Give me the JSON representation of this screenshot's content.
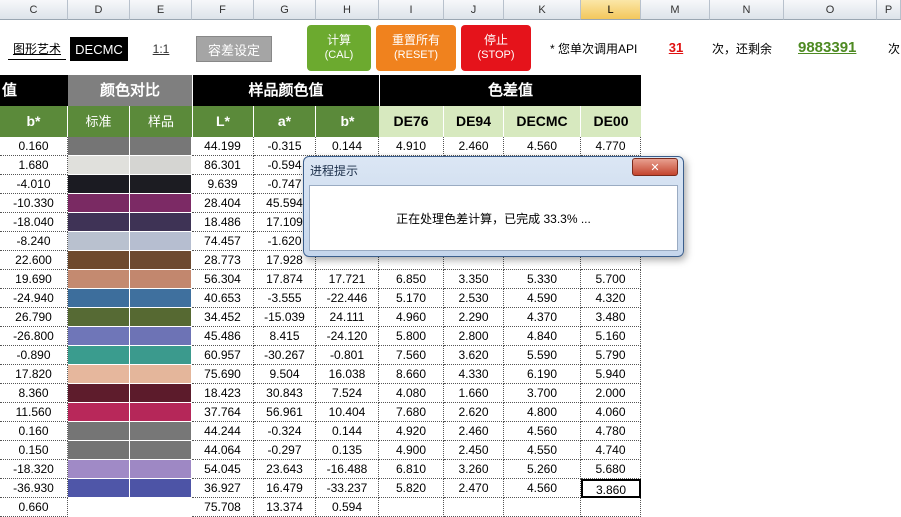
{
  "columns": [
    "C",
    "D",
    "E",
    "F",
    "G",
    "H",
    "I",
    "J",
    "K",
    "L",
    "M",
    "N",
    "O",
    "P"
  ],
  "controls": {
    "art_text": "图形艺术",
    "formula": "DECMC",
    "ratio": "1:1",
    "tolerance_btn": "容差设定",
    "calc_btn": {
      "label": "计算",
      "sub": "(CAL)"
    },
    "reset_btn": {
      "label": "重置所有",
      "sub": "(RESET)"
    },
    "stop_btn": {
      "label": "停止",
      "sub": "(STOP)"
    },
    "api_label": "* 您单次调用API",
    "api_count": "31",
    "remain_label": "次，还剩余",
    "remain_count": "9883391",
    "tail": "次"
  },
  "headers": {
    "value_partial": "值",
    "color_compare": "颜色对比",
    "sample_color": "样品颜色值",
    "color_diff": "色差值",
    "b_std": "b*",
    "standard": "标准",
    "sample": "样品",
    "L": "L*",
    "a": "a*",
    "b": "b*",
    "de76": "DE76",
    "de94": "DE94",
    "decmc": "DECMC",
    "de00": "DE00"
  },
  "rows": [
    {
      "b": "0.160",
      "std": "#757575",
      "smp": "#777777",
      "L": "44.199",
      "a": "-0.315",
      "bb": "0.144",
      "de76": "4.910",
      "de94": "2.460",
      "decmc": "4.560",
      "de00": "4.770"
    },
    {
      "b": "1.680",
      "std": "#e0e0dc",
      "smp": "#d5d5d2",
      "L": "86.301",
      "a": "-0.594",
      "bb": "",
      "de76": "",
      "de94": "",
      "decmc": "",
      "de00": ""
    },
    {
      "b": "-4.010",
      "std": "#1b1b22",
      "smp": "#1c1c22",
      "L": "9.639",
      "a": "-0.747",
      "bb": "",
      "de76": "",
      "de94": "",
      "decmc": "",
      "de00": ""
    },
    {
      "b": "-10.330",
      "std": "#7a2a63",
      "smp": "#7c2a65",
      "L": "28.404",
      "a": "45.594",
      "bb": "",
      "de76": "",
      "de94": "",
      "decmc": "",
      "de00": ""
    },
    {
      "b": "-18.040",
      "std": "#3f3356",
      "smp": "#3e3355",
      "L": "18.486",
      "a": "17.109",
      "bb": "",
      "de76": "",
      "de94": "",
      "decmc": "",
      "de00": ""
    },
    {
      "b": "-8.240",
      "std": "#b9c1cf",
      "smp": "#b6bed0",
      "L": "74.457",
      "a": "-1.620",
      "bb": "",
      "de76": "",
      "de94": "",
      "decmc": "",
      "de00": ""
    },
    {
      "b": "22.600",
      "std": "#6e4a2e",
      "smp": "#6d4a30",
      "L": "28.773",
      "a": "17.928",
      "bb": "",
      "de76": "",
      "de94": "",
      "decmc": "",
      "de00": ""
    },
    {
      "b": "19.690",
      "std": "#c48a70",
      "smp": "#c2876e",
      "L": "56.304",
      "a": "17.874",
      "bb": "17.721",
      "de76": "6.850",
      "de94": "3.350",
      "decmc": "5.330",
      "de00": "5.700"
    },
    {
      "b": "-24.940",
      "std": "#3d6e9c",
      "smp": "#3f709e",
      "L": "40.653",
      "a": "-3.555",
      "bb": "-22.446",
      "de76": "5.170",
      "de94": "2.530",
      "decmc": "4.590",
      "de00": "4.320"
    },
    {
      "b": "26.790",
      "std": "#566a34",
      "smp": "#566932",
      "L": "34.452",
      "a": "-15.039",
      "bb": "24.111",
      "de76": "4.960",
      "de94": "2.290",
      "decmc": "4.370",
      "de00": "3.480"
    },
    {
      "b": "-26.800",
      "std": "#6f76b8",
      "smp": "#6d73b5",
      "L": "45.486",
      "a": "8.415",
      "bb": "-24.120",
      "de76": "5.800",
      "de94": "2.800",
      "decmc": "4.840",
      "de00": "5.160"
    },
    {
      "b": "-0.890",
      "std": "#3a9c8e",
      "smp": "#3b9a8d",
      "L": "60.957",
      "a": "-30.267",
      "bb": "-0.801",
      "de76": "7.560",
      "de94": "3.620",
      "decmc": "5.590",
      "de00": "5.790"
    },
    {
      "b": "17.820",
      "std": "#e6b79d",
      "smp": "#e4b69b",
      "L": "75.690",
      "a": "9.504",
      "bb": "16.038",
      "de76": "8.660",
      "de94": "4.330",
      "decmc": "6.190",
      "de00": "5.940"
    },
    {
      "b": "8.360",
      "std": "#5e1c2c",
      "smp": "#5c1b2b",
      "L": "18.423",
      "a": "30.843",
      "bb": "7.524",
      "de76": "4.080",
      "de94": "1.660",
      "decmc": "3.700",
      "de00": "2.000"
    },
    {
      "b": "11.560",
      "std": "#b8285a",
      "smp": "#b52759",
      "L": "37.764",
      "a": "56.961",
      "bb": "10.404",
      "de76": "7.680",
      "de94": "2.620",
      "decmc": "4.800",
      "de00": "4.060"
    },
    {
      "b": "0.160",
      "std": "#757575",
      "smp": "#777777",
      "L": "44.244",
      "a": "-0.324",
      "bb": "0.144",
      "de76": "4.920",
      "de94": "2.460",
      "decmc": "4.560",
      "de00": "4.780"
    },
    {
      "b": "0.150",
      "std": "#747474",
      "smp": "#767676",
      "L": "44.064",
      "a": "-0.297",
      "bb": "0.135",
      "de76": "4.900",
      "de94": "2.450",
      "decmc": "4.550",
      "de00": "4.740"
    },
    {
      "b": "-18.320",
      "std": "#a08ac6",
      "smp": "#9e88c4",
      "L": "54.045",
      "a": "23.643",
      "bb": "-16.488",
      "de76": "6.810",
      "de94": "3.260",
      "decmc": "5.260",
      "de00": "5.680"
    },
    {
      "b": "-36.930",
      "std": "#4f56a8",
      "smp": "#4d54a6",
      "L": "36.927",
      "a": "16.479",
      "bb": "-33.237",
      "de76": "5.820",
      "de94": "2.470",
      "decmc": "4.560",
      "de00": "3.860"
    },
    {
      "b": "0.660",
      "std": "#ffffff",
      "smp": "#ffffff",
      "L": "75.708",
      "a": "13.374",
      "bb": "0.594",
      "de76": "",
      "de94": "",
      "decmc": "",
      "de00": ""
    }
  ],
  "dialog": {
    "title": "进程提示",
    "message": "正在处理色差计算，已完成 33.3% ...",
    "close": "✕"
  }
}
